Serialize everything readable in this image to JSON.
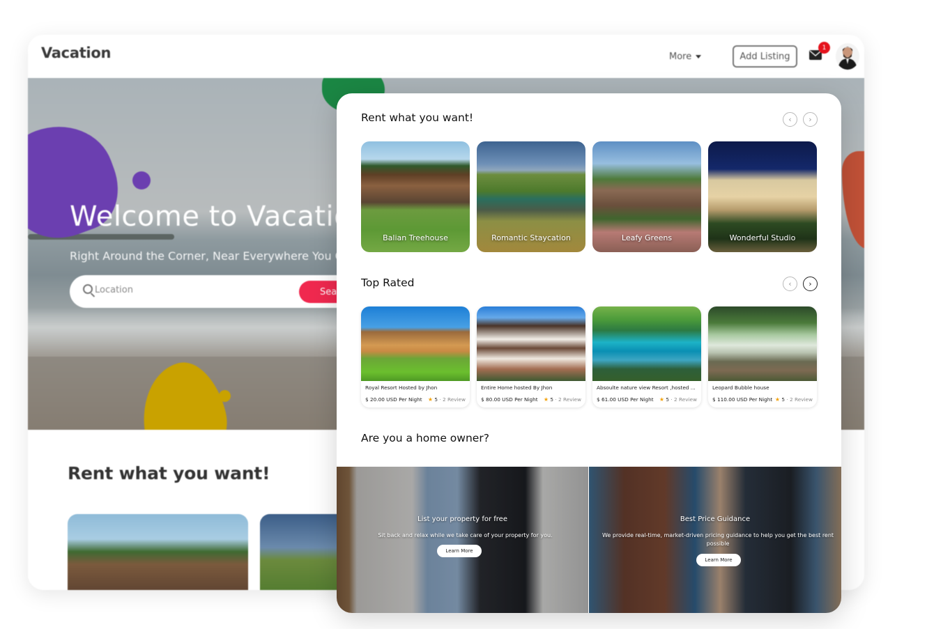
{
  "background_page": {
    "logo": "Vacation",
    "nav": {
      "more_label": "More",
      "add_listing_label": "Add Listing",
      "notification_count": "1",
      "mail_icon": "mail-icon",
      "avatar": "user-avatar"
    },
    "hero": {
      "title": "Welcome to Vacation",
      "subtitle": "Right Around the Corner, Near Everywhere You Go",
      "search_placeholder": "Location",
      "search_button": "Search"
    },
    "section_title": "Rent what you want!"
  },
  "foreground": {
    "rent_section": {
      "title": "Rent what you want!",
      "prev_icon": "chevron-left-icon",
      "next_icon": "chevron-right-icon",
      "items": [
        {
          "label": "Balian Treehouse"
        },
        {
          "label": "Romantic Staycation"
        },
        {
          "label": "Leafy Greens"
        },
        {
          "label": "Wonderful Studio"
        }
      ]
    },
    "top_rated": {
      "title": "Top Rated",
      "items": [
        {
          "name": "Royal Resort  Hosted by Jhon",
          "price": "$ 20.00 USD Per Night",
          "rating": "5",
          "reviews": "· 2 Review"
        },
        {
          "name": "Entire Home hosted By Jhon",
          "price": "$ 80.00 USD Per Night",
          "rating": "5",
          "reviews": "· 2 Review"
        },
        {
          "name": "Absoulte nature view Resort ,hosted ...",
          "price": "$ 61.00 USD Per Night",
          "rating": "5",
          "reviews": "· 2 Review"
        },
        {
          "name": "Leopard Bubble house",
          "price": "$ 110.00 USD Per Night",
          "rating": "5",
          "reviews": "· 2 Review"
        }
      ]
    },
    "home_owner": {
      "title": "Are you a home owner?",
      "panels": [
        {
          "title": "List your property for free",
          "description": "Sit back and relax while we take care of your property for you.",
          "button": "Learn More"
        },
        {
          "title": "Best Price Guidance",
          "description": "We provide real-time, market-driven pricing guidance to help you get the best rent possible",
          "button": "Learn More"
        }
      ]
    }
  },
  "colors": {
    "accent_pink": "#f0294f",
    "badge_red": "#e5131d",
    "star": "#f3a20b",
    "blob_purple": "#6b3fb0",
    "blob_green": "#1b8744",
    "blob_yellow": "#c9a200",
    "blob_orange": "#c15137"
  }
}
